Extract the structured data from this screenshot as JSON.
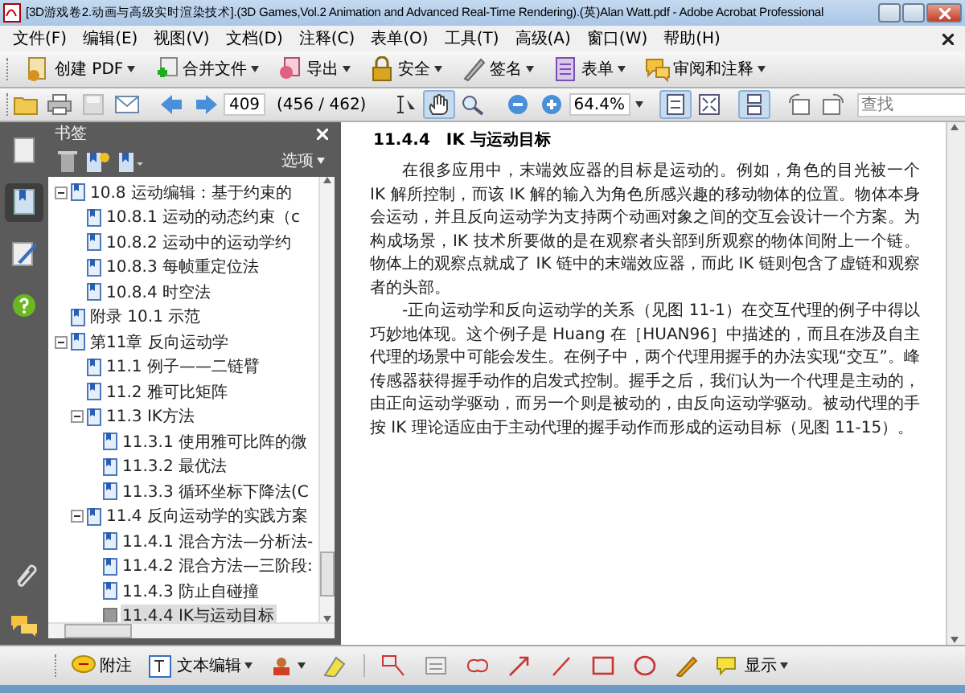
{
  "window": {
    "title": "[3D游戏卷2.动画与高级实时渲染技术].(3D Games,Vol.2 Animation and Advanced Real-Time Rendering).(英)Alan Watt.pdf - Adobe Acrobat Professional"
  },
  "menu": [
    "文件(F)",
    "编辑(E)",
    "视图(V)",
    "文档(D)",
    "注释(C)",
    "表单(O)",
    "工具(T)",
    "高级(A)",
    "窗口(W)",
    "帮助(H)"
  ],
  "task_toolbar": [
    {
      "label": "创建 PDF",
      "dropdown": true
    },
    {
      "label": "合并文件",
      "dropdown": true
    },
    {
      "label": "导出",
      "dropdown": true
    },
    {
      "label": "安全",
      "dropdown": true
    },
    {
      "label": "签名",
      "dropdown": true
    },
    {
      "label": "表单",
      "dropdown": true
    },
    {
      "label": "审阅和注释",
      "dropdown": true
    }
  ],
  "navigation": {
    "page": "409",
    "page_count": "(456 / 462)",
    "zoom": "64.4%",
    "search_placeholder": "查找"
  },
  "tools": [
    {
      "selected": false
    },
    {
      "selected": true
    },
    {
      "selected": false
    }
  ],
  "views": [
    {
      "selected": true
    },
    {
      "selected": false
    },
    {
      "selected": true
    }
  ],
  "rail": [
    {
      "selected": false
    },
    {
      "selected": true
    },
    {
      "selected": false
    },
    {
      "selected": false
    }
  ],
  "bookmarks": {
    "title": "书签",
    "options": "选项",
    "tree": [
      {
        "label": "10.8 运动编辑：基于约束的",
        "expanded": true,
        "selected": false,
        "children": [
          {
            "label": "10.8.1 运动的动态约束（c",
            "selected": false
          },
          {
            "label": "10.8.2 运动中的运动学约",
            "selected": false
          },
          {
            "label": "10.8.3 每帧重定位法",
            "selected": false
          },
          {
            "label": "10.8.4 时空法",
            "selected": false
          }
        ]
      },
      {
        "label": "附录 10.1 示范",
        "selected": false
      },
      {
        "label": "第11章 反向运动学",
        "expanded": true,
        "selected": false,
        "children": [
          {
            "label": "11.1 例子——二链臂",
            "selected": false
          },
          {
            "label": "11.2 雅可比矩阵",
            "selected": false
          },
          {
            "label": "11.3 IK方法",
            "expanded": true,
            "selected": false,
            "children": [
              {
                "label": "11.3.1 使用雅可比阵的微",
                "selected": false
              },
              {
                "label": "11.3.2 最优法",
                "selected": false
              },
              {
                "label": "11.3.3 循环坐标下降法(C",
                "selected": false
              }
            ]
          },
          {
            "label": "11.4 反向运动学的实践方案",
            "expanded": true,
            "selected": false,
            "children": [
              {
                "label": "11.4.1 混合方法—分析法-",
                "selected": false
              },
              {
                "label": "11.4.2 混合方法—三阶段:",
                "selected": false
              },
              {
                "label": "11.4.3 防止自碰撞",
                "selected": false
              },
              {
                "label": "11.4.4 IK与运动目标",
                "selected": true
              }
            ]
          }
        ]
      }
    ]
  },
  "document": {
    "heading": "11.4.4　IK 与运动目标",
    "paragraphs": [
      "在很多应用中，末端效应器的目标是运动的。例如，角色的目光被一个 IK 解所控制，而该 IK 解的输入为角色所感兴趣的移动物体的位置。物体本身会运动，并且反向运动学为支持两个动画对象之间的交互会设计一个方案。为构成场景，IK 技术所要做的是在观察者头部到所观察的物体间附上一个链。物体上的观察点就成了 IK 链中的末端效应器，而此 IK 链则包含了虚链和观察者的头部。",
      "-正向运动学和反向运动学的关系（见图 11-1）在交互代理的例子中得以巧妙地体现。这个例子是 Huang 在［HUAN96］中描述的，而且在涉及自主代理的场景中可能会发生。在例子中，两个代理用握手的办法实现“交互”。峰传感器获得握手动作的启发式控制。握手之后，我们认为一个代理是主动的，由正向运动学驱动，而另一个则是被动的，由反向运动学驱动。被动代理的手按 IK 理论适应由于主动代理的握手动作而形成的运动目标（见图 11-15）。"
    ]
  },
  "comment_toolbar": [
    {
      "label": "附注",
      "dropdown": false
    },
    {
      "label": "文本编辑",
      "dropdown": true
    },
    {
      "dropdown": true
    },
    {
      "label": "显示",
      "dropdown": true
    }
  ]
}
